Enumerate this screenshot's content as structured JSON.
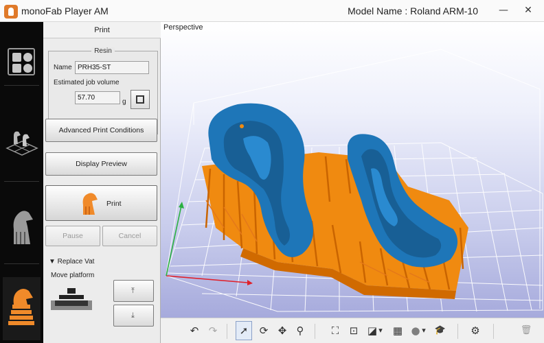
{
  "window": {
    "title": "monoFab Player AM",
    "model_name": "Model Name : Roland ARM-10",
    "minimize_glyph": "—",
    "close_glyph": "✕"
  },
  "panel": {
    "title": "Print",
    "resin_group": {
      "legend": "Resin",
      "name_label": "Name",
      "name_value": "PRH35-ST",
      "volume_label": "Estimated job volume",
      "volume_value": "57.70",
      "volume_unit": "g"
    },
    "advanced_button": "Advanced Print Conditions",
    "preview_button": "Display Preview",
    "print_button": "Print",
    "pause_button": "Pause",
    "cancel_button": "Cancel",
    "replace_vat": "▼  Replace Vat",
    "move_platform": "Move platform",
    "move_up_glyph": "⤒",
    "move_down_glyph": "⤓"
  },
  "viewport": {
    "label": "Perspective",
    "colors": {
      "model": "#1e76b8",
      "supports": "#f08a10",
      "grid": "#ffffff",
      "axis_x": "#e0202a",
      "axis_y": "#2ab040",
      "axis_z": "#3050d0"
    }
  },
  "toolbar": {
    "icons": [
      {
        "name": "undo-icon",
        "glyph": "↶"
      },
      {
        "name": "redo-icon",
        "glyph": "↷"
      },
      {
        "name": "select-arrow-icon",
        "glyph": "➚"
      },
      {
        "name": "rotate-icon",
        "glyph": "⟳"
      },
      {
        "name": "move-icon",
        "glyph": "✥"
      },
      {
        "name": "zoom-icon",
        "glyph": "⚲"
      },
      {
        "name": "fit-all-icon",
        "glyph": "⛶"
      },
      {
        "name": "fit-selection-icon",
        "glyph": "⊡"
      },
      {
        "name": "view-cube-icon",
        "glyph": "◪"
      },
      {
        "name": "view-cube-dropdown-icon",
        "glyph": "▾"
      },
      {
        "name": "grid-display-icon",
        "glyph": "▦"
      },
      {
        "name": "shading-icon",
        "glyph": "●"
      },
      {
        "name": "shading-dropdown-icon",
        "glyph": "▾"
      },
      {
        "name": "tutorial-cap-icon",
        "glyph": "🎓"
      },
      {
        "name": "settings-gear-icon",
        "glyph": "⚙"
      },
      {
        "name": "trash-icon",
        "glyph": "🗑"
      }
    ]
  }
}
